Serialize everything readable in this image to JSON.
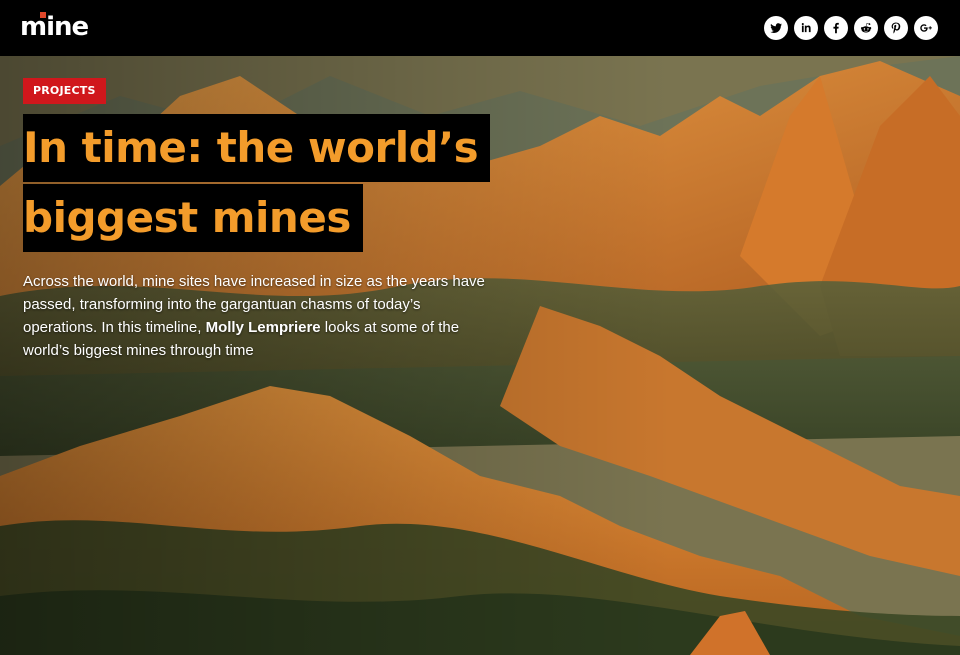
{
  "header": {
    "logo": "mine",
    "share_icons": [
      "twitter-icon",
      "linkedin-icon",
      "facebook-icon",
      "reddit-icon",
      "pinterest-icon",
      "google-plus-icon"
    ]
  },
  "article": {
    "category": "PROJECTS",
    "title_line_1": "In time: the world’s",
    "title_line_2": "biggest mines",
    "dek_before": "Across the world, mine sites have increased in size as the years have passed, transforming into the gargantuan chasms of today’s operations. In this timeline, ",
    "dek_author": "Molly Lempriere",
    "dek_after": " looks at some of the world’s biggest mines through time"
  },
  "colors": {
    "title_text": "#f39c2b",
    "title_bg": "#000000",
    "tag_bg": "#d0171c",
    "bar_bg": "#000000"
  }
}
